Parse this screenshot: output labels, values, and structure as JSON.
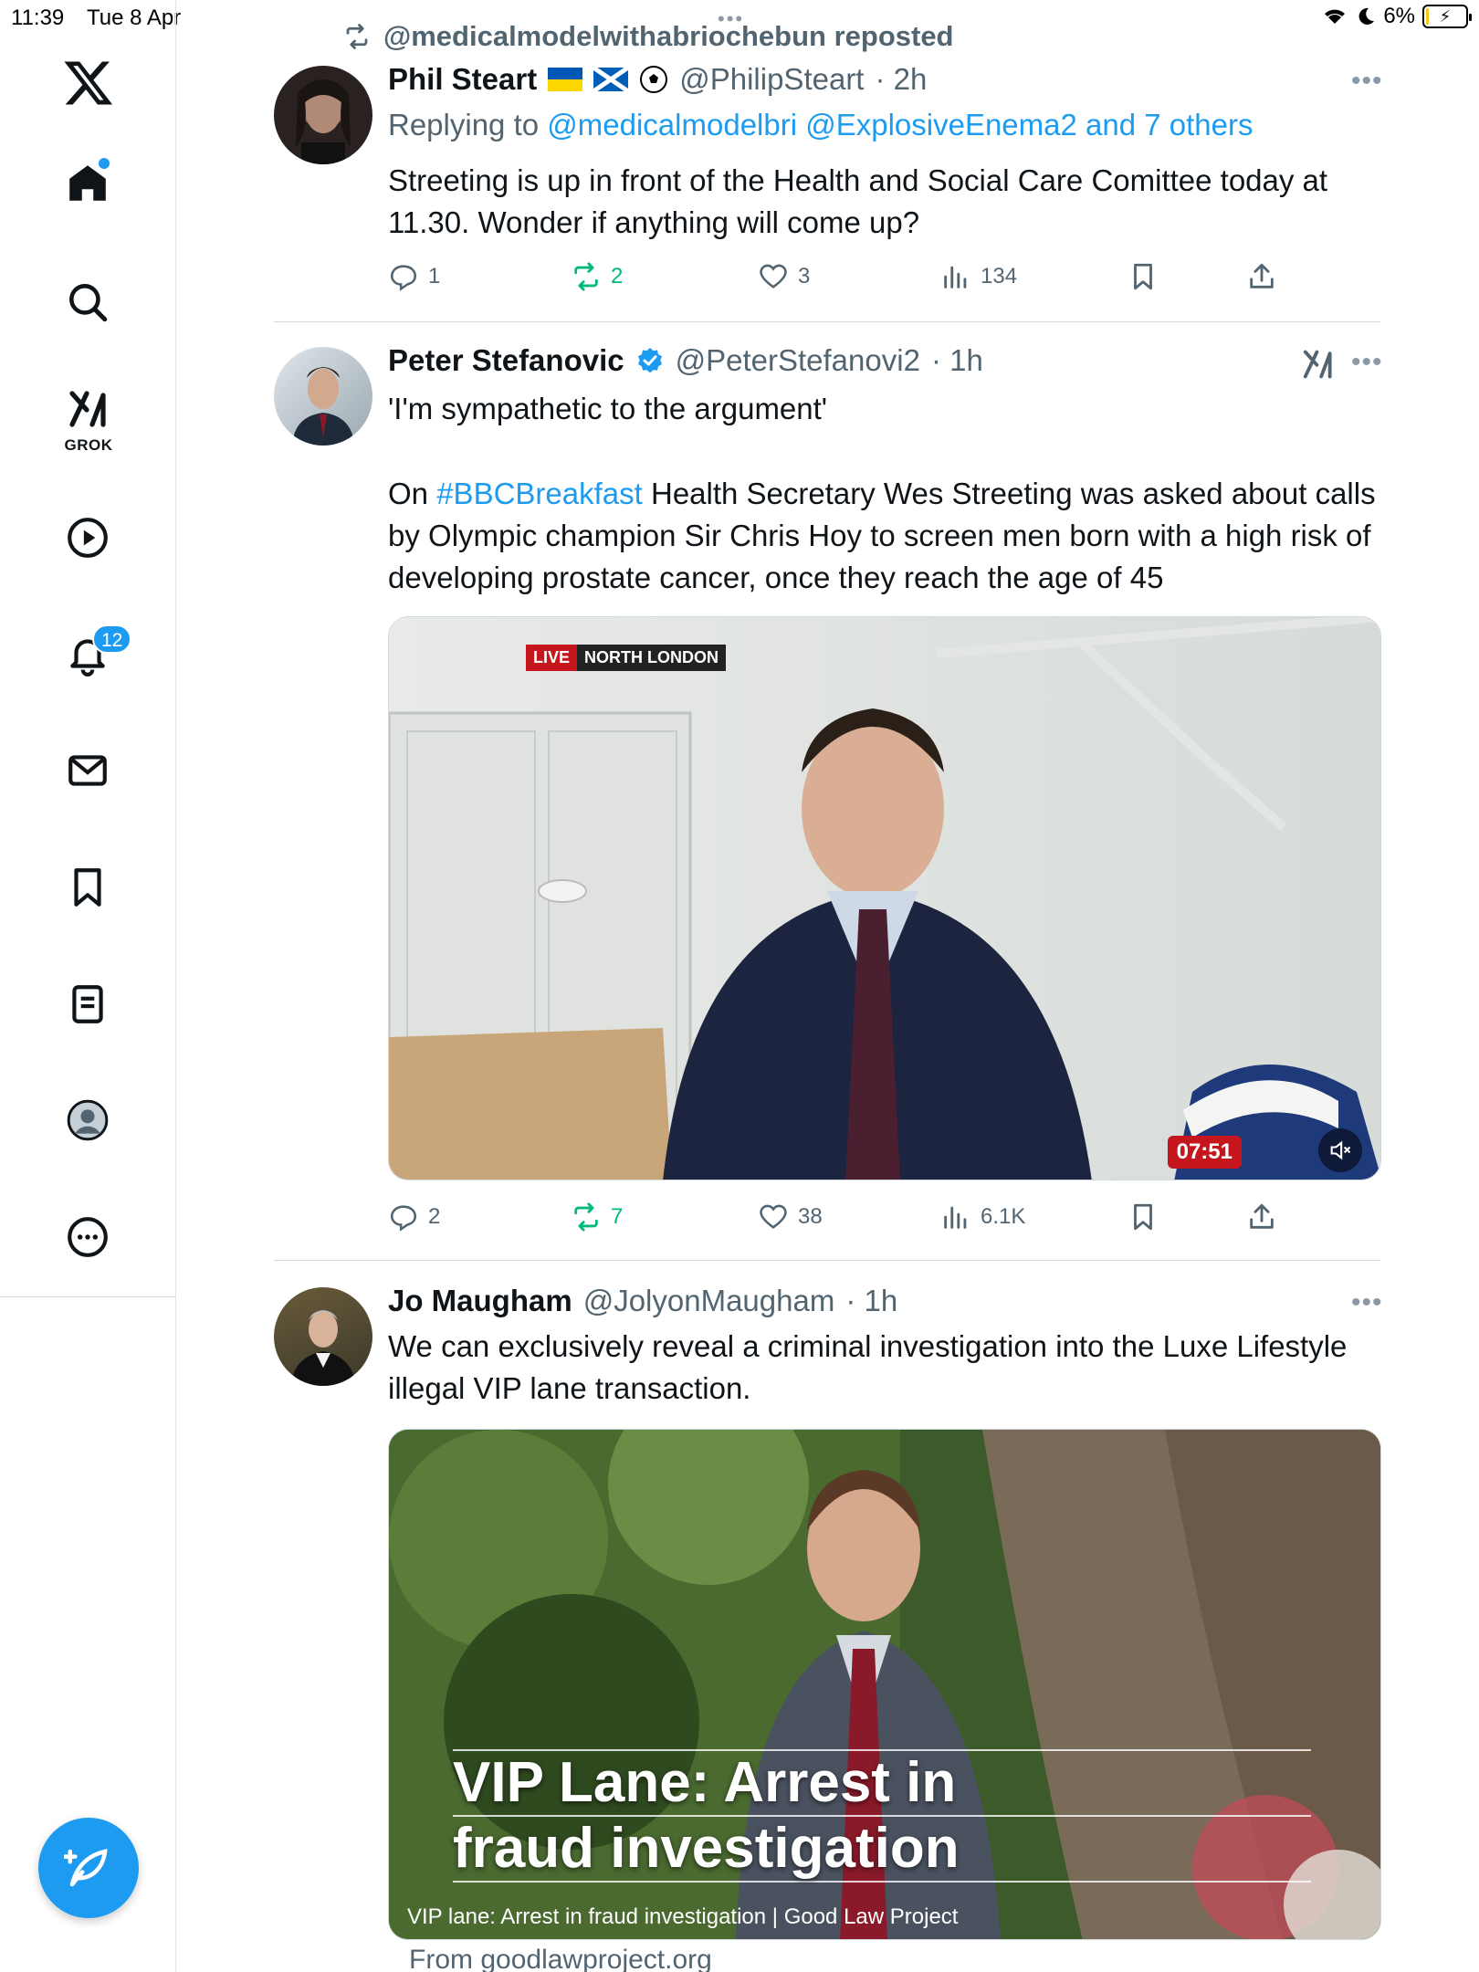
{
  "status_bar": {
    "time": "11:39",
    "date": "Tue 8 Apr",
    "battery": "6%",
    "battery_level": 0.06
  },
  "sidebar": {
    "logo": "x-logo",
    "grok_label": "GROK",
    "notifications_badge": "12",
    "items": [
      "home-icon",
      "search-icon",
      "grok-icon",
      "video-icon",
      "notifications-icon",
      "messages-icon",
      "bookmarks-icon",
      "lists-icon",
      "profile-icon",
      "more-icon"
    ]
  },
  "feed": {
    "repost_header": "@medicalmodelwithabriochebun reposted",
    "tweets": [
      {
        "name": "Phil Steart",
        "handle": "@PhilipSteart",
        "time": "· 2h",
        "reply_prefix": "Replying to",
        "reply_targets": "@medicalmodelbri @ExplosiveEnema2 and 7 others",
        "text": "Streeting is up in front of the Health and Social Care Comittee today at 11.30. Wonder if anything will come up?",
        "stats": {
          "replies": "1",
          "reposts": "2",
          "likes": "3",
          "views": "134"
        }
      },
      {
        "name": "Peter Stefanovic",
        "handle": "@PeterStefanovi2",
        "time": "· 1h",
        "text_line1": "'I'm sympathetic to the argument'",
        "text_pre": "On",
        "hashtag": "#BBCBreakfast",
        "text_post": "Health Secretary Wes Streeting was asked about calls by Olympic champion Sir Chris Hoy to screen men born with a high risk of developing prostate cancer, once they reach the age of 45",
        "video": {
          "live_tag": "LIVE",
          "location_tag": "NORTH LONDON",
          "duration": "07:51"
        },
        "stats": {
          "replies": "2",
          "reposts": "7",
          "likes": "38",
          "views": "6.1K"
        }
      },
      {
        "name": "Jo Maugham",
        "handle": "@JolyonMaugham",
        "time": "· 1h",
        "text": "We can exclusively reveal a criminal investigation into the Luxe Lifestyle illegal VIP lane transaction.",
        "card": {
          "headline_1": "VIP Lane: Arrest in",
          "headline_2": "fraud investigation",
          "caption": "VIP lane: Arrest in fraud investigation | Good Law Project",
          "source": "From goodlawproject.org"
        }
      }
    ]
  },
  "colors": {
    "accent": "#1d9bf0",
    "repost_green": "#00ba7c",
    "secondary_text": "#536471"
  }
}
